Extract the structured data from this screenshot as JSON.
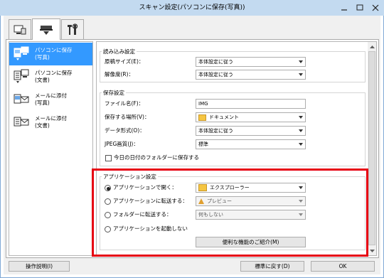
{
  "window": {
    "title": "スキャン設定(パソコンに保存(写真))"
  },
  "sidebar": {
    "items": [
      {
        "line1": "パソコンに保存",
        "line2": "(写真)",
        "selected": true
      },
      {
        "line1": "パソコンに保存",
        "line2": "(文書)",
        "selected": false
      },
      {
        "line1": "メールに添付",
        "line2": "(写真)",
        "selected": false
      },
      {
        "line1": "メールに添付",
        "line2": "(文書)",
        "selected": false
      }
    ]
  },
  "scan_settings": {
    "title": "読み込み設定",
    "paper_size_label": "原稿サイズ(E)：",
    "paper_size_value": "本体設定に従う",
    "resolution_label": "解像度(R)：",
    "resolution_value": "本体設定に従う"
  },
  "save_settings": {
    "title": "保存設定",
    "file_name_label": "ファイル名(F)：",
    "file_name_value": "IMG",
    "save_in_label": "保存する場所(V)：",
    "save_in_value": "ドキュメント",
    "data_format_label": "データ形式(O)：",
    "data_format_value": "本体設定に従う",
    "jpeg_quality_label": "JPEG画質(J)：",
    "jpeg_quality_value": "標準",
    "date_folder_label": "今日の日付のフォルダーに保存する"
  },
  "app_settings": {
    "title": "アプリケーション設定",
    "open_with_label": "アプリケーションで開く：",
    "open_with_value": "エクスプローラー",
    "send_to_app_label": "アプリケーションに転送する：",
    "send_to_app_value": "プレビュー",
    "send_to_folder_label": "フォルダーに転送する：",
    "send_to_folder_value": "何もしない",
    "do_not_start_label": "アプリケーションを起動しない",
    "features_button": "便利な機能のご紹介(M)"
  },
  "footer": {
    "instructions_button": "操作説明(I)",
    "defaults_button": "標準に戻す(D)",
    "ok_button": "OK"
  }
}
